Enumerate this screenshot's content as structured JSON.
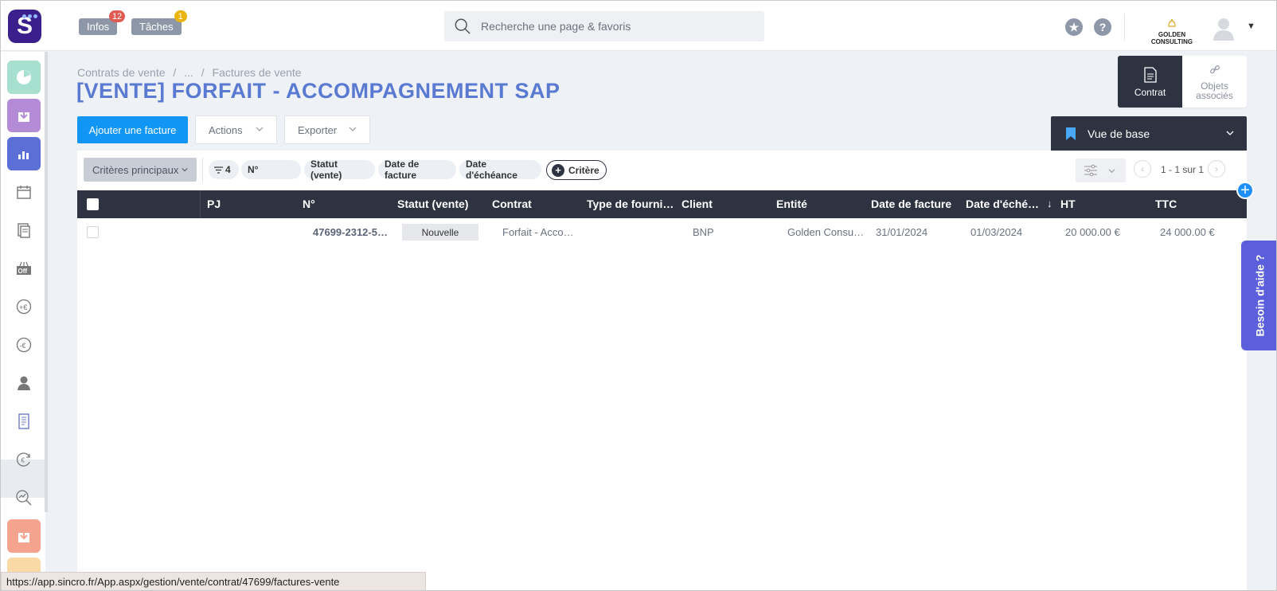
{
  "topbar": {
    "logo_letter": "S",
    "infos_label": "Infos",
    "infos_count": "12",
    "taches_label": "Tâches",
    "taches_count": "1",
    "search_placeholder": "Recherche une page & favoris",
    "help_icon_text": "?",
    "company_name": "GOLDEN CONSULTING"
  },
  "breadcrumb": [
    "Contrats de vente",
    "/",
    "...",
    "/",
    "Factures de vente"
  ],
  "page_title": "[VENTE] FORFAIT - ACCOMPAGNEMENT SAP",
  "toolbar": {
    "add_label": "Ajouter une facture",
    "actions_label": "Actions",
    "export_label": "Exporter"
  },
  "side_tabs": {
    "contrat_label": "Contrat",
    "objets_label_1": "Objets",
    "objets_label_2": "associés"
  },
  "view": {
    "label": "Vue de base"
  },
  "filters": {
    "main_label": "Critères principaux",
    "count": "4",
    "chips": [
      "N°",
      "Statut (vente)",
      "Date de facture",
      "Date d'échéance"
    ],
    "add_label": "Critère"
  },
  "pager": {
    "text": "1 - 1 sur 1",
    "prev": "‹",
    "next": "›"
  },
  "table": {
    "headers": [
      "PJ",
      "N°",
      "Statut (vente)",
      "Contrat",
      "Type de fourni…",
      "Client",
      "Entité",
      "Date de facture",
      "Date d'éché…",
      "HT",
      "TTC"
    ],
    "sort_indicator": "↓",
    "rows": [
      {
        "pj": "",
        "numero": "47699-2312-5…",
        "statut": "Nouvelle",
        "contrat": "Forfait - Acco…",
        "type": "",
        "client": "BNP",
        "entite": "Golden Consu…",
        "date_facture": "31/01/2024",
        "date_echeance": "01/03/2024",
        "ht": "20 000.00 €",
        "ttc": "24 000.00 €"
      }
    ]
  },
  "help_tab": "Besoin d'aide ?",
  "add_icon_text": "+",
  "status_url": "https://app.sincro.fr/App.aspx/gestion/vente/contrat/47699/factures-vente",
  "colors": {
    "primary": "#1296f5",
    "title": "#5a79d1",
    "dark": "#2d3341",
    "help": "#5b5fdb",
    "badge_red": "#e05a52",
    "badge_yellow": "#e9b40c"
  },
  "rail_icons": [
    "dashboard-icon",
    "download-icon",
    "chart-icon",
    "calendar-icon",
    "documents-icon",
    "off-icon",
    "plus-euro-icon",
    "minus-euro-icon",
    "user-icon",
    "invoice-icon",
    "euro-cycle-icon",
    "search-chart-icon",
    "export-icon"
  ]
}
